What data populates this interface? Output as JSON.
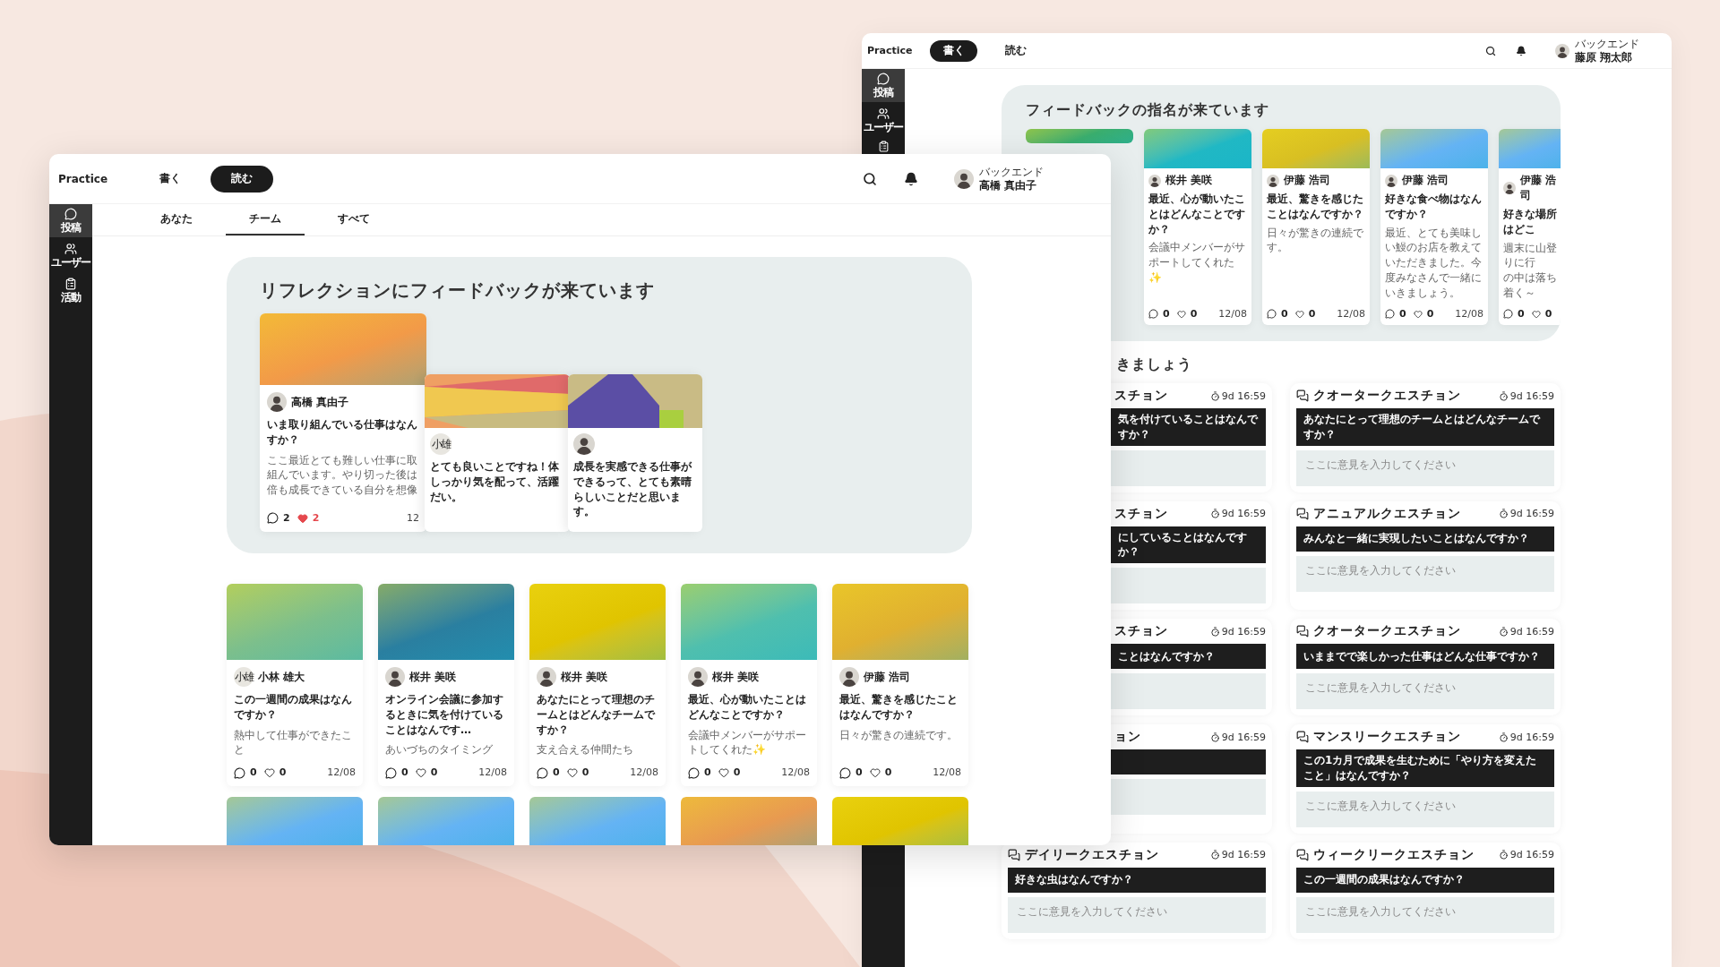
{
  "back_window": {
    "brand": "Practice",
    "nav": [
      {
        "label": "書く",
        "selected": true
      },
      {
        "label": "読む",
        "selected": false
      }
    ],
    "user": {
      "role": "バックエンド",
      "name": "藤原 翔太郎"
    },
    "sidebar": [
      {
        "label": "投稿",
        "selected": true
      },
      {
        "label": "ユーザー",
        "selected": false
      }
    ],
    "feedback_panel": {
      "title": "フィードバックの指名が来ています",
      "cards": [
        {
          "color": "#3aae6e"
        },
        {
          "color": "#20b8c4",
          "author": "桜井 美咲",
          "title": "最近、心が動いたことはどんなことですか？",
          "body_lines": [
            "会議中メンバーがサポートしてくれた✨"
          ],
          "comments": "0",
          "likes": "0",
          "liked": false,
          "date": "12/08"
        },
        {
          "color": "#d8bf22",
          "author": "伊藤 浩司",
          "title": "最近、驚きを感じたことはなんですか？",
          "body_lines": [
            "日々が驚きの連続です。"
          ],
          "comments": "0",
          "likes": "0",
          "liked": false,
          "date": "12/08"
        },
        {
          "color": "#64b3f4",
          "author": "伊藤 浩司",
          "title": "好きな食べ物はなんですか？",
          "body_lines": [
            "最近、とても美味しい鰻のお店を教えていただきました。今度みなさんで一緒にいきましょう。"
          ],
          "comments": "0",
          "likes": "0",
          "liked": false,
          "date": "12/08"
        },
        {
          "color": "#64b3f4",
          "author": "伊藤 浩司",
          "title": "好きな場所はどこ",
          "body_lines": [
            "週末に山登りに行",
            "の中は落ち着く～"
          ],
          "comments": "0",
          "likes": "0",
          "liked": false
        }
      ]
    },
    "questions": {
      "heading": "きましょう",
      "items": [
        {
          "covered": true,
          "title": "スチョン",
          "time": "9d 16:59",
          "question": "気を付けていることはなんですか？"
        },
        {
          "covered": false,
          "title": "クオータークエスチョン",
          "time": "9d 16:59",
          "question": "あなたにとって理想のチームとはどんなチームですか？",
          "placeholder": "ここに意見を入力してください"
        },
        {
          "covered": true,
          "title": "スチョン",
          "time": "9d 16:59",
          "question": "にしていることはなんですか？"
        },
        {
          "covered": false,
          "title": "アニュアルクエスチョン",
          "time": "9d 16:59",
          "question": "みんなと一緒に実現したいことはなんですか？",
          "placeholder": "ここに意見を入力してください"
        },
        {
          "covered": true,
          "title": "スチョン",
          "time": "9d 16:59",
          "question": "ことはなんですか？"
        },
        {
          "covered": false,
          "title": "クオータークエスチョン",
          "time": "9d 16:59",
          "question": "いままでで楽しかった仕事はどんな仕事ですか？",
          "placeholder": "ここに意見を入力してください"
        },
        {
          "covered": true,
          "title": "ョン",
          "time": "9d 16:59"
        },
        {
          "covered": false,
          "title": "マンスリークエスチョン",
          "time": "9d 16:59",
          "question": "この1カ月で成果を生むために「やり方を変えたこと」はなんですか？",
          "placeholder": "ここに意見を入力してください"
        },
        {
          "covered": false,
          "title": "デイリークエスチョン",
          "time": "9d 16:59",
          "question": "好きな虫はなんですか？",
          "placeholder": "ここに意見を入力してください"
        },
        {
          "covered": false,
          "title": "ウィークリークエスチョン",
          "time": "9d 16:59",
          "question": "この一週間の成果はなんですか？",
          "placeholder": "ここに意見を入力してください"
        }
      ]
    }
  },
  "front_window": {
    "brand": "Practice",
    "nav": [
      {
        "label": "書く",
        "selected": false
      },
      {
        "label": "読む",
        "selected": true
      }
    ],
    "user": {
      "role": "バックエンド",
      "name": "高橋 真由子"
    },
    "sidebar": [
      {
        "label": "投稿",
        "selected": true
      },
      {
        "label": "ユーザー",
        "selected": false
      },
      {
        "label": "活動",
        "selected": false
      }
    ],
    "tabs": [
      {
        "label": "あなた",
        "selected": false
      },
      {
        "label": "チーム",
        "selected": true
      },
      {
        "label": "すべて",
        "selected": false
      }
    ],
    "feedback_panel": {
      "title": "リフレクションにフィードバックが来ています",
      "reflection": {
        "color": "#f29a48",
        "author": "高橋 真由子",
        "title_lines": [
          "いま取り組んでいる仕事はなん",
          "すか？"
        ],
        "body_lines": [
          "ここ最近とても難しい仕事に取",
          "組んでいます。やり切った後は",
          "倍も成長できている自分を想像"
        ],
        "comments": "2",
        "likes": "2",
        "liked": true,
        "date": "12"
      },
      "replies": [
        {
          "avatar_text": "小雄",
          "lines": [
            "とても良いことですね！体",
            "しっかり気を配って、活躍",
            "だい。"
          ]
        },
        {
          "lines": [
            "成長を実感できる仕事ができるって、とても素晴らしいことだと思います。"
          ]
        }
      ]
    },
    "posts": [
      {
        "color": "#7cbf8c",
        "avatar_text": "小雄",
        "author": "小林 雄大",
        "title": "この一週間の成果はなんですか？",
        "body_lines": [
          "熱中して仕事ができたこと"
        ],
        "comments": "0",
        "likes": "0",
        "liked": false,
        "date": "12/08"
      },
      {
        "color": "#2a7fa0",
        "author": "桜井 美咲",
        "title": "オンライン会議に参加するときに気を付けていることはなんです…",
        "body_lines": [
          "あいづちのタイミング"
        ],
        "comments": "0",
        "likes": "0",
        "liked": false,
        "date": "12/08"
      },
      {
        "color": "#e0c400",
        "author": "桜井 美咲",
        "title": "あなたにとって理想のチームとはどんなチームですか？",
        "body_lines": [
          "支え合える仲間たち"
        ],
        "comments": "0",
        "likes": "0",
        "liked": false,
        "date": "12/08"
      },
      {
        "color": "#4fbfae",
        "author": "桜井 美咲",
        "title": "最近、心が動いたことはどんなことですか？",
        "body_lines": [
          "会議中メンバーがサポートしてくれた✨"
        ],
        "comments": "0",
        "likes": "0",
        "liked": false,
        "date": "12/08"
      },
      {
        "color": "#e0b030",
        "author": "伊藤 浩司",
        "title": "最近、驚きを感じたことはなんですか？",
        "body_lines": [
          "日々が驚きの連続です。"
        ],
        "comments": "0",
        "likes": "0",
        "liked": false,
        "date": "12/08"
      }
    ],
    "next_posts": [
      {
        "color": "#64b3f4"
      },
      {
        "color": "#64b3f4"
      },
      {
        "color": "#64b3f4"
      },
      {
        "color": "#e89a50"
      },
      {
        "color": "#e0c400"
      }
    ]
  }
}
